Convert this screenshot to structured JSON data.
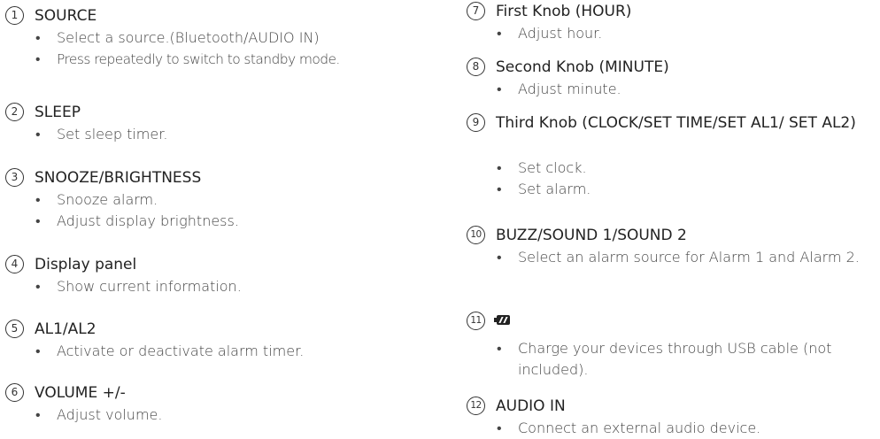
{
  "left": [
    {
      "num": "1",
      "title": "SOURCE",
      "bullets": [
        "Select a source.(Bluetooth/AUDIO IN)",
        "Press repeatedly to switch to standby mode."
      ]
    },
    {
      "num": "2",
      "title": "SLEEP",
      "bullets": [
        "Set sleep timer."
      ]
    },
    {
      "num": "3",
      "title": "SNOOZE/BRIGHTNESS",
      "bullets": [
        "Snooze alarm.",
        "Adjust display brightness."
      ]
    },
    {
      "num": "4",
      "title": "Display panel",
      "bullets": [
        "Show current information."
      ]
    },
    {
      "num": "5",
      "title": "AL1/AL2",
      "bullets": [
        "Activate or deactivate alarm timer."
      ]
    },
    {
      "num": "6",
      "title": "VOLUME +/-",
      "bullets": [
        "Adjust volume."
      ]
    }
  ],
  "right": [
    {
      "num": "7",
      "title": "First Knob (HOUR)",
      "bullets": [
        "Adjust hour."
      ]
    },
    {
      "num": "8",
      "title": "Second Knob (MINUTE)",
      "bullets": [
        "Adjust minute."
      ]
    },
    {
      "num": "9",
      "title": "Third Knob (CLOCK/SET TIME/SET AL1/ SET AL2)",
      "bullets": [
        "Set clock.",
        "Set alarm."
      ]
    },
    {
      "num": "10",
      "title": "BUZZ/SOUND 1/SOUND 2",
      "bullets": [
        "Select an alarm source for Alarm 1 and Alarm 2."
      ]
    },
    {
      "num": "11",
      "icon": "usb-charge-icon",
      "bullets": [
        "Charge your devices through USB cable (not included)."
      ]
    },
    {
      "num": "12",
      "title": "AUDIO IN",
      "bullets": [
        "Connect an external audio device."
      ]
    }
  ]
}
